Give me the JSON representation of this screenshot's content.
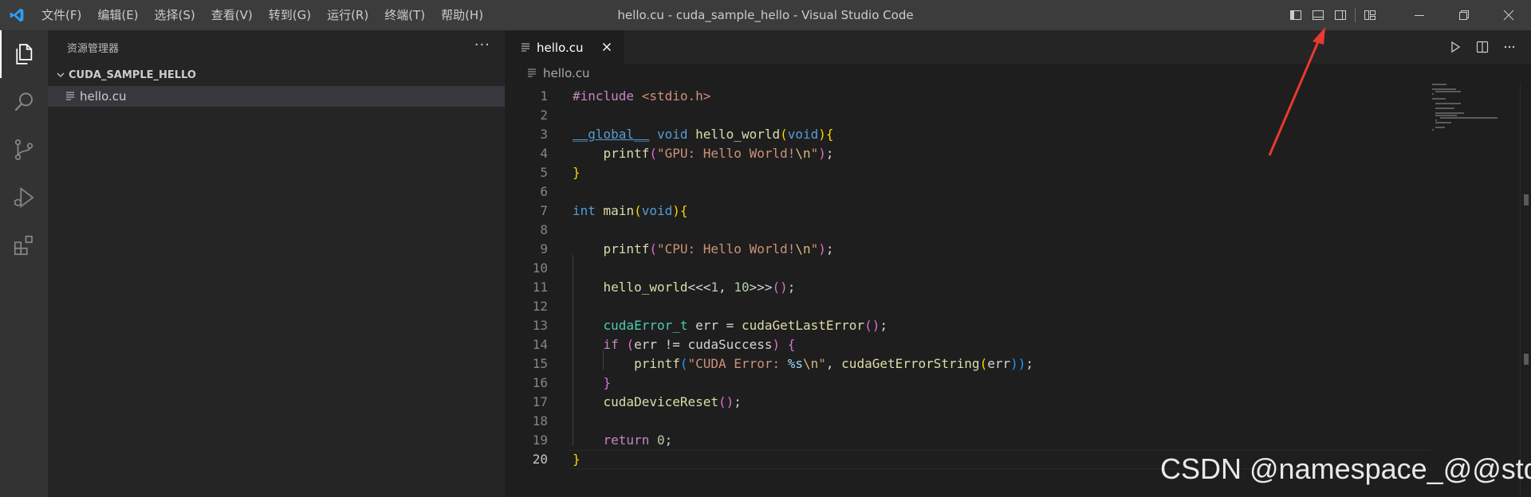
{
  "window": {
    "title": "hello.cu - cuda_sample_hello - Visual Studio Code"
  },
  "menu": [
    "文件(F)",
    "编辑(E)",
    "选择(S)",
    "查看(V)",
    "转到(G)",
    "运行(R)",
    "终端(T)",
    "帮助(H)"
  ],
  "icons": {
    "logo": "vscode-logo-icon",
    "activity": [
      "explorer-icon",
      "search-icon",
      "source-control-icon",
      "run-debug-icon",
      "extensions-icon"
    ],
    "layout": [
      "toggle-primary-sidebar-icon",
      "toggle-panel-icon",
      "toggle-secondary-sidebar-icon",
      "customize-layout-icon"
    ],
    "window": [
      "minimize-icon",
      "restore-icon",
      "close-icon"
    ],
    "editor_actions": [
      "run-icon",
      "split-editor-icon",
      "more-actions-icon"
    ]
  },
  "sidebar": {
    "title": "资源管理器",
    "more": "···",
    "folder": "CUDA_SAMPLE_HELLO",
    "files": [
      "hello.cu"
    ]
  },
  "editor": {
    "tab_label": "hello.cu",
    "breadcrumb": "hello.cu",
    "current_line": 20,
    "lines": [
      [
        [
          "#include ",
          "t-dir"
        ],
        [
          "<stdio.h>",
          "t-inc"
        ]
      ],
      [],
      [
        [
          "__global__",
          "t-kw t-under"
        ],
        [
          " ",
          "t-p"
        ],
        [
          "void",
          "t-kw"
        ],
        [
          " ",
          "t-p"
        ],
        [
          "hello_world",
          "t-fn"
        ],
        [
          "(",
          "t-b1"
        ],
        [
          "void",
          "t-kw"
        ],
        [
          "){",
          "t-b1"
        ]
      ],
      [
        [
          "    ",
          "t-p"
        ],
        [
          "printf",
          "t-fn"
        ],
        [
          "(",
          "t-b2"
        ],
        [
          "\"GPU: Hello World!",
          "t-str"
        ],
        [
          "\\n",
          "t-esc"
        ],
        [
          "\"",
          "t-str"
        ],
        [
          ")",
          "t-b2"
        ],
        [
          ";",
          "t-p"
        ]
      ],
      [
        [
          "}",
          "t-b1"
        ]
      ],
      [],
      [
        [
          "int",
          "t-kw"
        ],
        [
          " ",
          "t-p"
        ],
        [
          "main",
          "t-fn"
        ],
        [
          "(",
          "t-b1"
        ],
        [
          "void",
          "t-kw"
        ],
        [
          "){",
          "t-b1"
        ]
      ],
      [],
      [
        [
          "    ",
          "t-p"
        ],
        [
          "printf",
          "t-fn"
        ],
        [
          "(",
          "t-b2"
        ],
        [
          "\"CPU: Hello World!",
          "t-str"
        ],
        [
          "\\n",
          "t-esc"
        ],
        [
          "\"",
          "t-str"
        ],
        [
          ")",
          "t-b2"
        ],
        [
          ";",
          "t-p"
        ]
      ],
      [],
      [
        [
          "    ",
          "t-p"
        ],
        [
          "hello_world",
          "t-fn"
        ],
        [
          "<<<",
          "t-p"
        ],
        [
          "1",
          "t-num"
        ],
        [
          ", ",
          "t-p"
        ],
        [
          "10",
          "t-num"
        ],
        [
          ">>>",
          "t-p"
        ],
        [
          "()",
          "t-b2"
        ],
        [
          ";",
          "t-p"
        ]
      ],
      [],
      [
        [
          "    ",
          "t-p"
        ],
        [
          "cudaError_t",
          "t-type"
        ],
        [
          " err = ",
          "t-p"
        ],
        [
          "cudaGetLastError",
          "t-fn"
        ],
        [
          "()",
          "t-b2"
        ],
        [
          ";",
          "t-p"
        ]
      ],
      [
        [
          "    ",
          "t-p"
        ],
        [
          "if",
          "t-ctl"
        ],
        [
          " ",
          "t-p"
        ],
        [
          "(",
          "t-b2"
        ],
        [
          "err != cudaSuccess",
          "t-p"
        ],
        [
          ")",
          "t-b2"
        ],
        [
          " ",
          "t-p"
        ],
        [
          "{",
          "t-b2"
        ]
      ],
      [
        [
          "        ",
          "t-p"
        ],
        [
          "printf",
          "t-fn"
        ],
        [
          "(",
          "t-b3"
        ],
        [
          "\"CUDA Error: ",
          "t-str"
        ],
        [
          "%s",
          "t-fmt"
        ],
        [
          "\\n",
          "t-esc"
        ],
        [
          "\"",
          "t-str"
        ],
        [
          ", ",
          "t-p"
        ],
        [
          "cudaGetErrorString",
          "t-fn"
        ],
        [
          "(",
          "t-b1"
        ],
        [
          "err",
          "t-p"
        ],
        [
          "))",
          "t-b3"
        ],
        [
          ";",
          "t-p"
        ]
      ],
      [
        [
          "    ",
          "t-p"
        ],
        [
          "}",
          "t-b2"
        ]
      ],
      [
        [
          "    ",
          "t-p"
        ],
        [
          "cudaDeviceReset",
          "t-fn"
        ],
        [
          "()",
          "t-b2"
        ],
        [
          ";",
          "t-p"
        ]
      ],
      [],
      [
        [
          "    ",
          "t-p"
        ],
        [
          "return",
          "t-ctl"
        ],
        [
          " ",
          "t-p"
        ],
        [
          "0",
          "t-num"
        ],
        [
          ";",
          "t-p"
        ]
      ],
      [
        [
          "}",
          "t-b1"
        ]
      ]
    ]
  },
  "watermark": "CSDN @namespace_@@std",
  "colors": {
    "titlebar": "#3c3c3c",
    "activitybar": "#333333",
    "sidebar": "#252526",
    "editor": "#1e1e1e",
    "annotation_arrow": "#e83a2f"
  }
}
